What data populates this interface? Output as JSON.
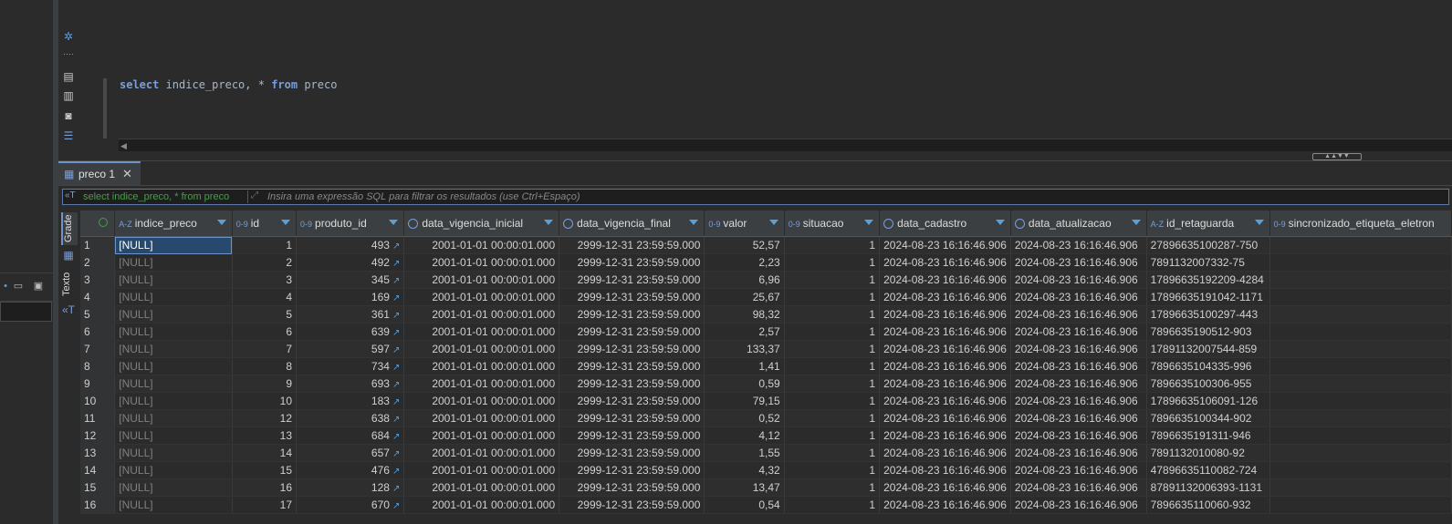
{
  "editor": {
    "code_kw1": "select",
    "code_mid": " indice_preco, * ",
    "code_kw2": "from",
    "code_end": " preco"
  },
  "result_tab": {
    "label": "preco 1"
  },
  "filter": {
    "query": "select indice_preco, * from preco",
    "hint": "Insira uma expressão SQL para filtrar os resultados (use Ctrl+Espaço)"
  },
  "side_tabs": {
    "grid": "Grade",
    "text": "Texto"
  },
  "columns": [
    {
      "type": "A-Z",
      "name": "indice_preco"
    },
    {
      "type": "0-9",
      "name": "id"
    },
    {
      "type": "0-9",
      "name": "produto_id"
    },
    {
      "type": "clock",
      "name": "data_vigencia_inicial"
    },
    {
      "type": "clock",
      "name": "data_vigencia_final"
    },
    {
      "type": "0-9",
      "name": "valor"
    },
    {
      "type": "0-9",
      "name": "situacao"
    },
    {
      "type": "clock",
      "name": "data_cadastro"
    },
    {
      "type": "clock",
      "name": "data_atualizacao"
    },
    {
      "type": "A-Z",
      "name": "id_retaguarda"
    },
    {
      "type": "0-9",
      "name": "sincronizado_etiqueta_eletron"
    }
  ],
  "rows": [
    [
      "1",
      "[NULL]",
      "1",
      "493",
      "2001-01-01 00:00:01.000",
      "2999-12-31 23:59:59.000",
      "52,57",
      "1",
      "2024-08-23 16:16:46.906",
      "2024-08-23 16:16:46.906",
      "27896635100287-750"
    ],
    [
      "2",
      "[NULL]",
      "2",
      "492",
      "2001-01-01 00:00:01.000",
      "2999-12-31 23:59:59.000",
      "2,23",
      "1",
      "2024-08-23 16:16:46.906",
      "2024-08-23 16:16:46.906",
      "7891132007332-75"
    ],
    [
      "3",
      "[NULL]",
      "3",
      "345",
      "2001-01-01 00:00:01.000",
      "2999-12-31 23:59:59.000",
      "6,96",
      "1",
      "2024-08-23 16:16:46.906",
      "2024-08-23 16:16:46.906",
      "17896635192209-4284"
    ],
    [
      "4",
      "[NULL]",
      "4",
      "169",
      "2001-01-01 00:00:01.000",
      "2999-12-31 23:59:59.000",
      "25,67",
      "1",
      "2024-08-23 16:16:46.906",
      "2024-08-23 16:16:46.906",
      "17896635191042-1171"
    ],
    [
      "5",
      "[NULL]",
      "5",
      "361",
      "2001-01-01 00:00:01.000",
      "2999-12-31 23:59:59.000",
      "98,32",
      "1",
      "2024-08-23 16:16:46.906",
      "2024-08-23 16:16:46.906",
      "17896635100297-443"
    ],
    [
      "6",
      "[NULL]",
      "6",
      "639",
      "2001-01-01 00:00:01.000",
      "2999-12-31 23:59:59.000",
      "2,57",
      "1",
      "2024-08-23 16:16:46.906",
      "2024-08-23 16:16:46.906",
      "7896635190512-903"
    ],
    [
      "7",
      "[NULL]",
      "7",
      "597",
      "2001-01-01 00:00:01.000",
      "2999-12-31 23:59:59.000",
      "133,37",
      "1",
      "2024-08-23 16:16:46.906",
      "2024-08-23 16:16:46.906",
      "17891132007544-859"
    ],
    [
      "8",
      "[NULL]",
      "8",
      "734",
      "2001-01-01 00:00:01.000",
      "2999-12-31 23:59:59.000",
      "1,41",
      "1",
      "2024-08-23 16:16:46.906",
      "2024-08-23 16:16:46.906",
      "7896635104335-996"
    ],
    [
      "9",
      "[NULL]",
      "9",
      "693",
      "2001-01-01 00:00:01.000",
      "2999-12-31 23:59:59.000",
      "0,59",
      "1",
      "2024-08-23 16:16:46.906",
      "2024-08-23 16:16:46.906",
      "7896635100306-955"
    ],
    [
      "10",
      "[NULL]",
      "10",
      "183",
      "2001-01-01 00:00:01.000",
      "2999-12-31 23:59:59.000",
      "79,15",
      "1",
      "2024-08-23 16:16:46.906",
      "2024-08-23 16:16:46.906",
      "17896635106091-126"
    ],
    [
      "11",
      "[NULL]",
      "12",
      "638",
      "2001-01-01 00:00:01.000",
      "2999-12-31 23:59:59.000",
      "0,52",
      "1",
      "2024-08-23 16:16:46.906",
      "2024-08-23 16:16:46.906",
      "7896635100344-902"
    ],
    [
      "12",
      "[NULL]",
      "13",
      "684",
      "2001-01-01 00:00:01.000",
      "2999-12-31 23:59:59.000",
      "4,12",
      "1",
      "2024-08-23 16:16:46.906",
      "2024-08-23 16:16:46.906",
      "7896635191311-946"
    ],
    [
      "13",
      "[NULL]",
      "14",
      "657",
      "2001-01-01 00:00:01.000",
      "2999-12-31 23:59:59.000",
      "1,55",
      "1",
      "2024-08-23 16:16:46.906",
      "2024-08-23 16:16:46.906",
      "7891132010080-92"
    ],
    [
      "14",
      "[NULL]",
      "15",
      "476",
      "2001-01-01 00:00:01.000",
      "2999-12-31 23:59:59.000",
      "4,32",
      "1",
      "2024-08-23 16:16:46.906",
      "2024-08-23 16:16:46.906",
      "47896635110082-724"
    ],
    [
      "15",
      "[NULL]",
      "16",
      "128",
      "2001-01-01 00:00:01.000",
      "2999-12-31 23:59:59.000",
      "13,47",
      "1",
      "2024-08-23 16:16:46.906",
      "2024-08-23 16:16:46.906",
      "87891132006393-1131"
    ],
    [
      "16",
      "[NULL]",
      "17",
      "670",
      "2001-01-01 00:00:01.000",
      "2999-12-31 23:59:59.000",
      "0,54",
      "1",
      "2024-08-23 16:16:46.906",
      "2024-08-23 16:16:46.906",
      "7896635110060-932"
    ]
  ],
  "colors": {
    "accent": "#6e93c8",
    "type_badge": "#7a9fd6",
    "selected": "#27496d"
  }
}
